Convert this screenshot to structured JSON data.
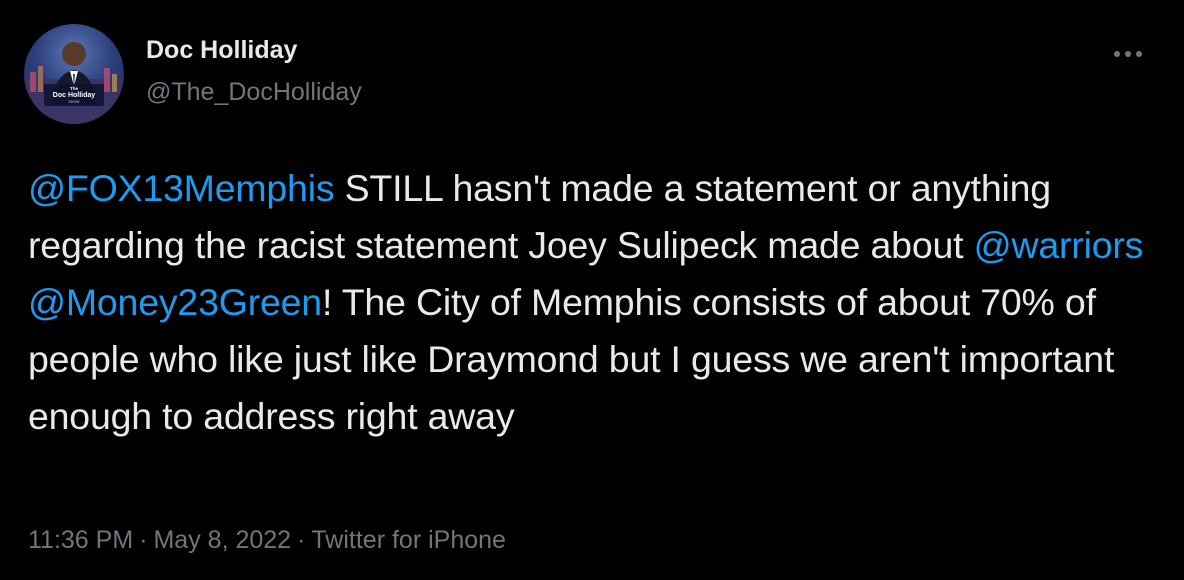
{
  "author": {
    "display_name": "Doc Holliday",
    "handle": "@The_DocHolliday",
    "avatar_text": {
      "line1": "The",
      "line2": "Doc Holliday",
      "line3": "SHOW"
    }
  },
  "tweet": {
    "segments": [
      {
        "type": "mention",
        "text": "@FOX13Memphis"
      },
      {
        "type": "text",
        "text": " STILL hasn't made a statement or anything regarding the racist statement Joey Sulipeck made about "
      },
      {
        "type": "mention",
        "text": "@warriors"
      },
      {
        "type": "text",
        "text": " "
      },
      {
        "type": "mention",
        "text": "@Money23Green"
      },
      {
        "type": "text",
        "text": "! The City of Memphis consists of about 70% of people who like just like Draymond but I guess we aren't important enough to address right away"
      }
    ]
  },
  "meta": {
    "time": "11:36 PM",
    "separator": "·",
    "date": "May 8, 2022",
    "source": "Twitter for iPhone"
  },
  "icons": {
    "more": "more-horizontal-icon"
  },
  "colors": {
    "background": "#000000",
    "text": "#e7e9ea",
    "secondary": "#71767b",
    "accent": "#1d9bf0"
  }
}
